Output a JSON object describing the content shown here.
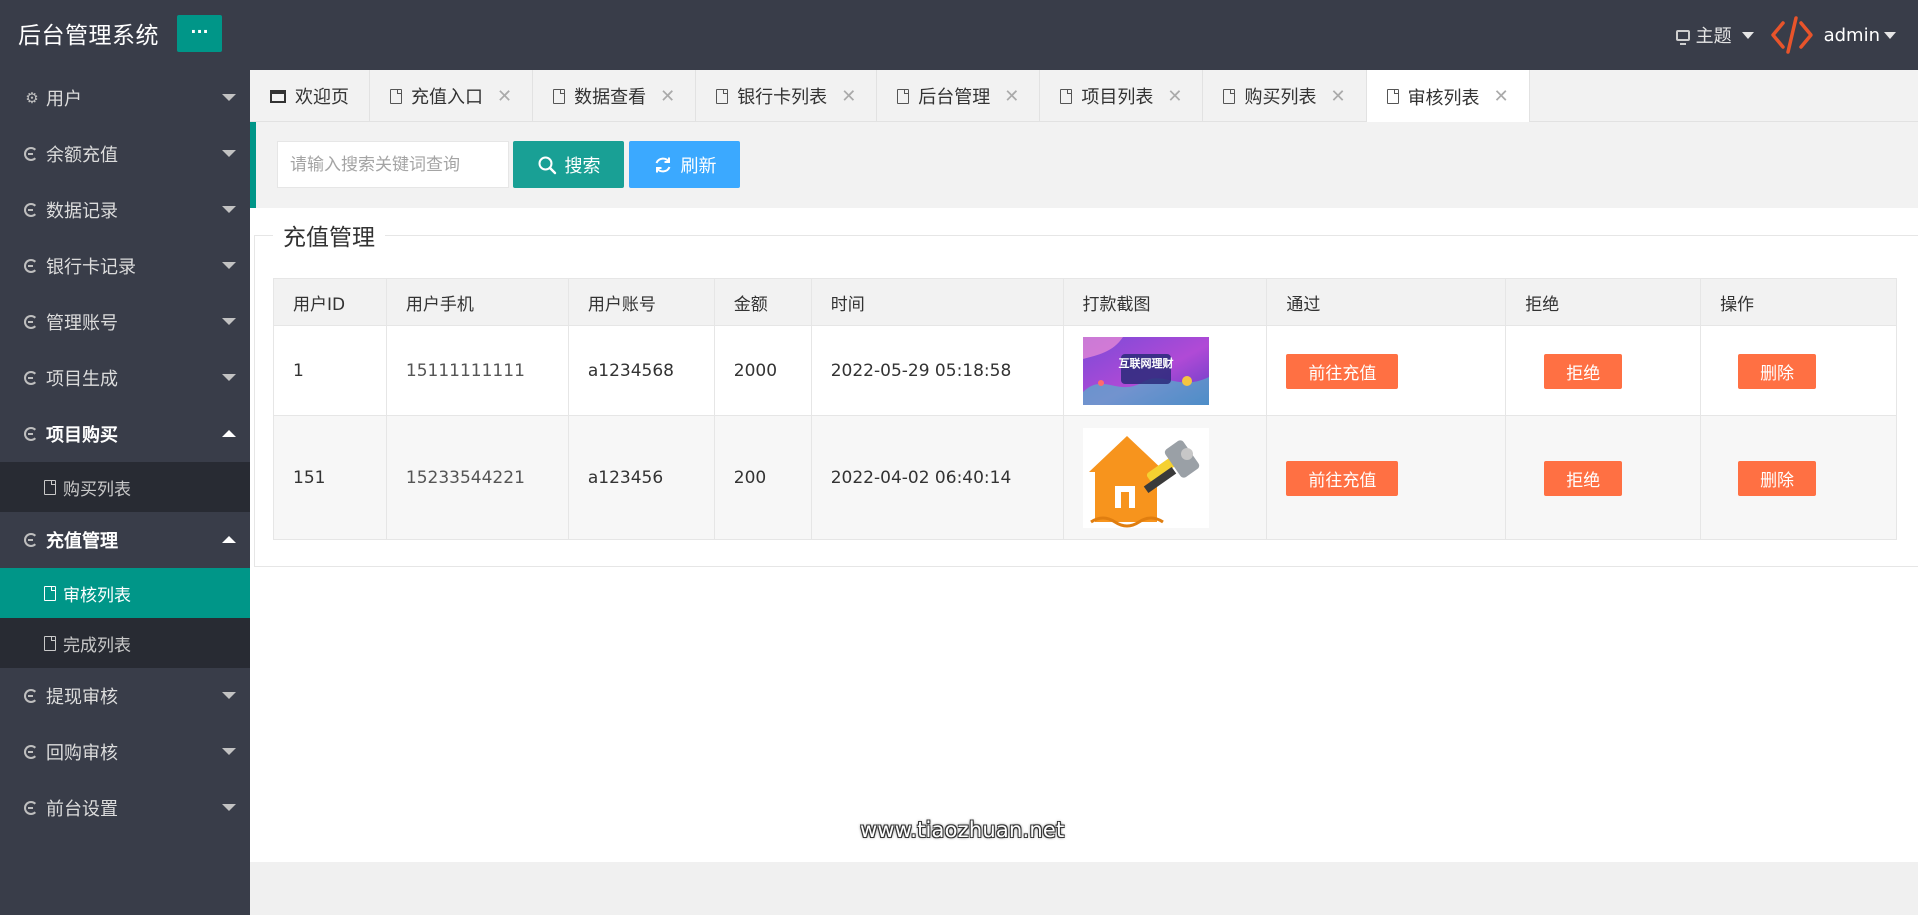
{
  "header": {
    "title": "后台管理系统",
    "menu_button": "···",
    "theme_label": "主题",
    "user": "admin"
  },
  "sidebar": {
    "items": [
      {
        "label": "用户",
        "icon": "gear-icon",
        "state": "collapsed"
      },
      {
        "label": "余额充值",
        "icon": "refresh-icon",
        "state": "collapsed"
      },
      {
        "label": "数据记录",
        "icon": "refresh-icon",
        "state": "collapsed"
      },
      {
        "label": "银行卡记录",
        "icon": "refresh-icon",
        "state": "collapsed"
      },
      {
        "label": "管理账号",
        "icon": "refresh-icon",
        "state": "collapsed"
      },
      {
        "label": "项目生成",
        "icon": "refresh-icon",
        "state": "collapsed"
      },
      {
        "label": "项目购买",
        "icon": "refresh-icon",
        "state": "expanded",
        "children": [
          {
            "label": "购买列表"
          }
        ]
      },
      {
        "label": "充值管理",
        "icon": "refresh-icon",
        "state": "expanded",
        "children": [
          {
            "label": "审核列表",
            "active": true
          },
          {
            "label": "完成列表"
          }
        ]
      },
      {
        "label": "提现审核",
        "icon": "refresh-icon",
        "state": "collapsed"
      },
      {
        "label": "回购审核",
        "icon": "refresh-icon",
        "state": "collapsed"
      },
      {
        "label": "前台设置",
        "icon": "refresh-icon",
        "state": "collapsed"
      }
    ]
  },
  "tabs": [
    {
      "label": "欢迎页",
      "closable": false
    },
    {
      "label": "充值入口",
      "closable": true
    },
    {
      "label": "数据查看",
      "closable": true
    },
    {
      "label": "银行卡列表",
      "closable": true
    },
    {
      "label": "后台管理",
      "closable": true
    },
    {
      "label": "项目列表",
      "closable": true
    },
    {
      "label": "购买列表",
      "closable": true
    },
    {
      "label": "审核列表",
      "closable": true,
      "active": true
    }
  ],
  "toolbar": {
    "search_placeholder": "请输入搜索关键词查询",
    "search_label": "搜索",
    "refresh_label": "刷新"
  },
  "section": {
    "title": "充值管理"
  },
  "table": {
    "headers": [
      "用户ID",
      "用户手机",
      "用户账号",
      "金额",
      "时间",
      "打款截图",
      "通过",
      "拒绝",
      "操作"
    ],
    "rows": [
      {
        "id": "1",
        "phone": "15111111111",
        "account": "a1234568",
        "amount": "2000",
        "time": "2022-05-29 05:18:58",
        "image_text": "互联网理财",
        "approve": "前往充值",
        "reject": "拒绝",
        "delete": "删除"
      },
      {
        "id": "151",
        "phone": "15233544221",
        "account": "a123456",
        "amount": "200",
        "time": "2022-04-02 06:40:14",
        "image_text": "",
        "approve": "前往充值",
        "reject": "拒绝",
        "delete": "删除"
      }
    ]
  },
  "watermark": "www.tiaozhuan.net",
  "colors": {
    "header_bg": "#393d49",
    "accent": "#009688",
    "search_btn": "#19a095",
    "refresh_btn": "#3ba9ff",
    "action_btn": "#ff7043"
  }
}
